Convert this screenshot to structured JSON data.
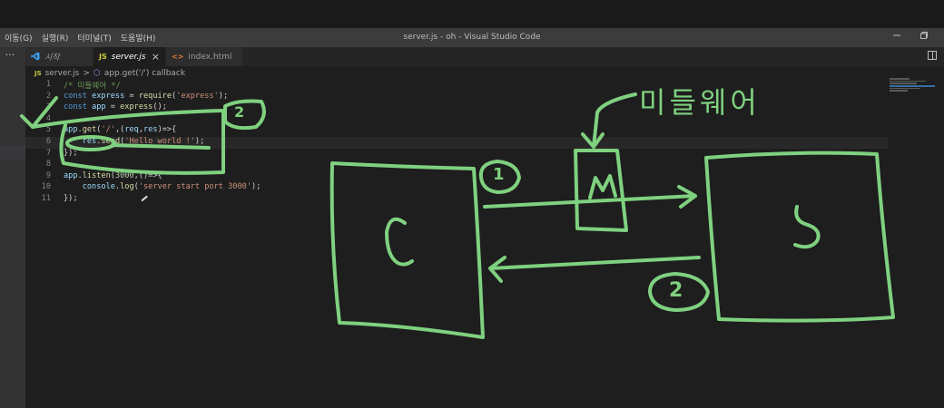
{
  "window": {
    "menu": [
      "이동(G)",
      "실행(R)",
      "터미널(T)",
      "도움말(H)"
    ],
    "title": "server.js - oh - Visual Studio Code",
    "minimize_icon": "minimize-icon",
    "restore_icon": "restore-icon"
  },
  "activity": {
    "more": "···"
  },
  "tabs": [
    {
      "icon": "vscode-icon",
      "label": "시작",
      "active": false
    },
    {
      "icon": "js-icon",
      "icon_text": "JS",
      "label": "server.js",
      "active": true,
      "close": "×"
    },
    {
      "icon": "html-icon",
      "icon_text": "<>",
      "label": "index.html",
      "active": false
    }
  ],
  "breadcrumb": {
    "file_icon": "JS",
    "file": "server.js",
    "sep": ">",
    "symbol": "app.get('/') callback"
  },
  "editor": {
    "lines": [
      {
        "n": "1",
        "tokens": [
          [
            "cm",
            "/* 미들웨어 */"
          ]
        ]
      },
      {
        "n": "2",
        "tokens": [
          [
            "kw",
            "const"
          ],
          [
            "punc",
            " "
          ],
          [
            "var",
            "express"
          ],
          [
            "punc",
            " = "
          ],
          [
            "fn",
            "require"
          ],
          [
            "punc",
            "("
          ],
          [
            "str",
            "'express'"
          ],
          [
            "punc",
            ");"
          ]
        ]
      },
      {
        "n": "3",
        "tokens": [
          [
            "kw",
            "const"
          ],
          [
            "punc",
            " "
          ],
          [
            "var",
            "app"
          ],
          [
            "punc",
            " = "
          ],
          [
            "fn",
            "express"
          ],
          [
            "punc",
            "();"
          ]
        ]
      },
      {
        "n": "4",
        "tokens": []
      },
      {
        "n": "5",
        "tokens": [
          [
            "var",
            "app"
          ],
          [
            "punc",
            "."
          ],
          [
            "fn",
            "get"
          ],
          [
            "punc",
            "("
          ],
          [
            "str",
            "'/'"
          ],
          [
            "punc",
            ",("
          ],
          [
            "var",
            "req"
          ],
          [
            "punc",
            ","
          ],
          [
            "var",
            "res"
          ],
          [
            "punc",
            ")=>{"
          ]
        ]
      },
      {
        "n": "6",
        "tokens": [
          [
            "punc",
            "    "
          ],
          [
            "var",
            "res"
          ],
          [
            "punc",
            "."
          ],
          [
            "fn",
            "send"
          ],
          [
            "punc",
            "("
          ],
          [
            "str",
            "'Hello world !'"
          ],
          [
            "punc",
            ");"
          ]
        ]
      },
      {
        "n": "7",
        "tokens": [
          [
            "punc",
            "});"
          ]
        ]
      },
      {
        "n": "8",
        "tokens": []
      },
      {
        "n": "9",
        "tokens": [
          [
            "var",
            "app"
          ],
          [
            "punc",
            "."
          ],
          [
            "fn",
            "listen"
          ],
          [
            "punc",
            "("
          ],
          [
            "num",
            "3000"
          ],
          [
            "punc",
            ",()=>{"
          ]
        ]
      },
      {
        "n": "10",
        "tokens": [
          [
            "punc",
            "    "
          ],
          [
            "var",
            "console"
          ],
          [
            "punc",
            "."
          ],
          [
            "fn",
            "log"
          ],
          [
            "punc",
            "("
          ],
          [
            "str",
            "'server start port 3000'"
          ],
          [
            "punc",
            ");"
          ]
        ]
      },
      {
        "n": "11",
        "tokens": [
          [
            "punc",
            "});"
          ]
        ]
      }
    ],
    "current_line": 6
  },
  "annotation": {
    "color": "#7fd17f",
    "labels": {
      "middleware": "미들웨어",
      "client": "C",
      "server": "S",
      "middleware_box": "M",
      "step1": "1",
      "step2": "2",
      "code_step": "2"
    }
  }
}
